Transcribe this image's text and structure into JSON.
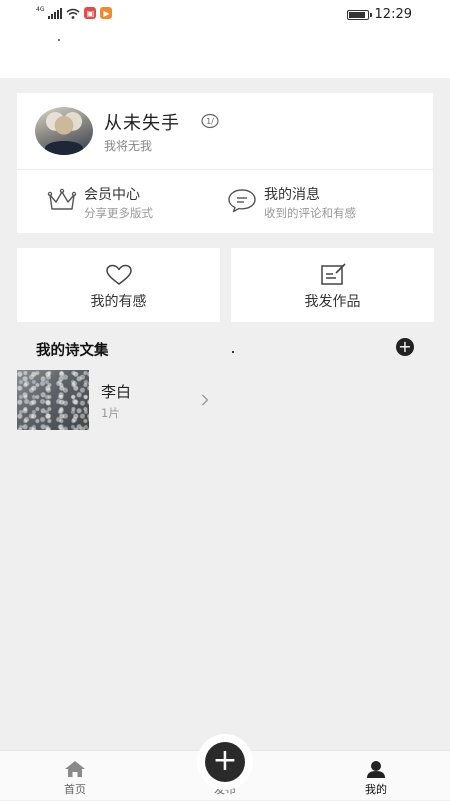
{
  "status_bar": {
    "network_tag": "4G",
    "time": "12:29",
    "battery_level": 0.9,
    "app_badge_colors": [
      "#e24b4b",
      "#f08a2c"
    ]
  },
  "profile": {
    "username": "从未失手",
    "bio": "我将无我"
  },
  "quick_links": [
    {
      "title": "会员中心",
      "subtitle": "分享更多版式",
      "icon": "crown-icon"
    },
    {
      "title": "我的消息",
      "subtitle": "收到的评论和有感",
      "icon": "message-bubble-icon"
    }
  ],
  "tiles": [
    {
      "label": "我的有感",
      "icon": "heart-icon"
    },
    {
      "label": "我发作品",
      "icon": "edit-note-icon"
    }
  ],
  "collections_section": {
    "title": "我的诗文集",
    "add_symbol": "+"
  },
  "collections": [
    {
      "name": "李白",
      "count": "1片"
    }
  ],
  "tabbar": {
    "items": [
      {
        "label": "首页",
        "icon": "home-icon"
      },
      {
        "label": "发布",
        "icon": "plus-icon"
      },
      {
        "label": "我的",
        "icon": "person-icon",
        "active": true
      }
    ],
    "fab_symbol": "+"
  }
}
